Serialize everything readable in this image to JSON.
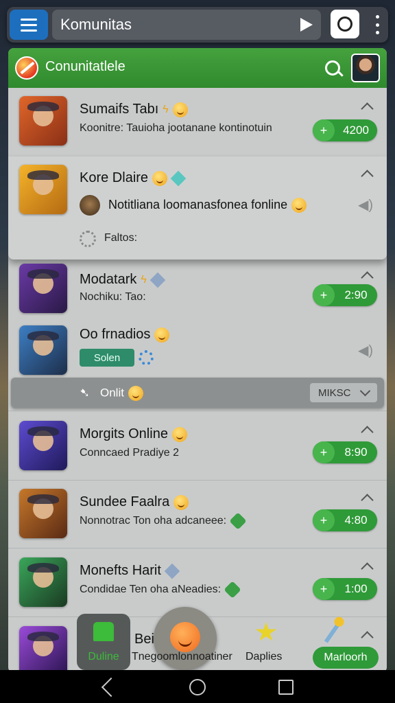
{
  "topbar": {
    "search_value": "Komunitas"
  },
  "header": {
    "title": "Conunitatlele"
  },
  "rows": [
    {
      "title": "Sumaifs Tabı",
      "subtitle": "Koonitre: Tauioha jootanane kontinotuin",
      "value": "4200"
    },
    {
      "title": "Kore Dlaire"
    },
    {
      "title": "Modatark",
      "subtitle": "Nochiku: Tao:",
      "value": "2:90"
    },
    {
      "title": "Oo frnadios",
      "tag": "Solen"
    },
    {
      "title": "Morgits Online",
      "subtitle": "Conncaed Pradiye 2",
      "value": "8:90"
    },
    {
      "title": "Sundee Faalra",
      "subtitle": "Nonnotrac Ton oha adcaneee:",
      "value": "4:80"
    },
    {
      "title": "Monefts Harit",
      "subtitle": "Condidae Ten oha aNeadies:",
      "value": "1:00"
    },
    {
      "title": "Beid"
    }
  ],
  "popup": {
    "message": "Notitliana loomanasfonea fonline",
    "status": "Faltos:"
  },
  "online_bar": {
    "label": "Onlit",
    "select_value": "MIKSC"
  },
  "bottom_nav": {
    "home_label": "Duline",
    "center_text": "Tnegoomlonnoatiner",
    "right_text": "Daplies",
    "pill_label": "Marloorh"
  },
  "colors": {
    "accent_green": "#2f9a38",
    "header_green": "#45a23d",
    "menu_blue": "#1d6fbe"
  },
  "icons": [
    "menu-icon",
    "play-icon",
    "circle-icon",
    "kebab-icon",
    "search-icon",
    "chevron-up-icon",
    "plus-icon",
    "speaker-icon",
    "gear-icon",
    "tag-icon",
    "chevron-down-icon",
    "home-icon",
    "star-icon",
    "wand-icon"
  ]
}
